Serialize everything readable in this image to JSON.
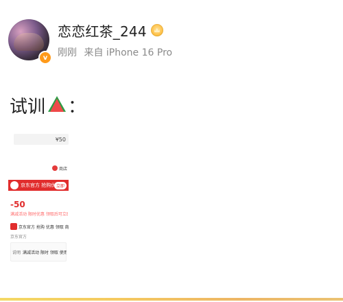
{
  "header": {
    "username": "恋恋红茶_244",
    "meta": {
      "time": "刚刚",
      "source": "来自 iPhone 16 Pro"
    }
  },
  "post": {
    "text": "试训",
    "colon": "："
  },
  "image_card": {
    "price": "¥50",
    "shop_label": "商店",
    "promo": {
      "text": "京东官方 抢购优惠",
      "pill": "立即"
    },
    "amount": "-50",
    "red_note": "满减活动 限时优惠 领取后可立即使用",
    "product_title": "京东官方 抢购 优惠 领取 商品",
    "sub_note": "京东官方",
    "detail": {
      "label": "说明",
      "text": "满减活动 限时 领取 使用"
    }
  }
}
